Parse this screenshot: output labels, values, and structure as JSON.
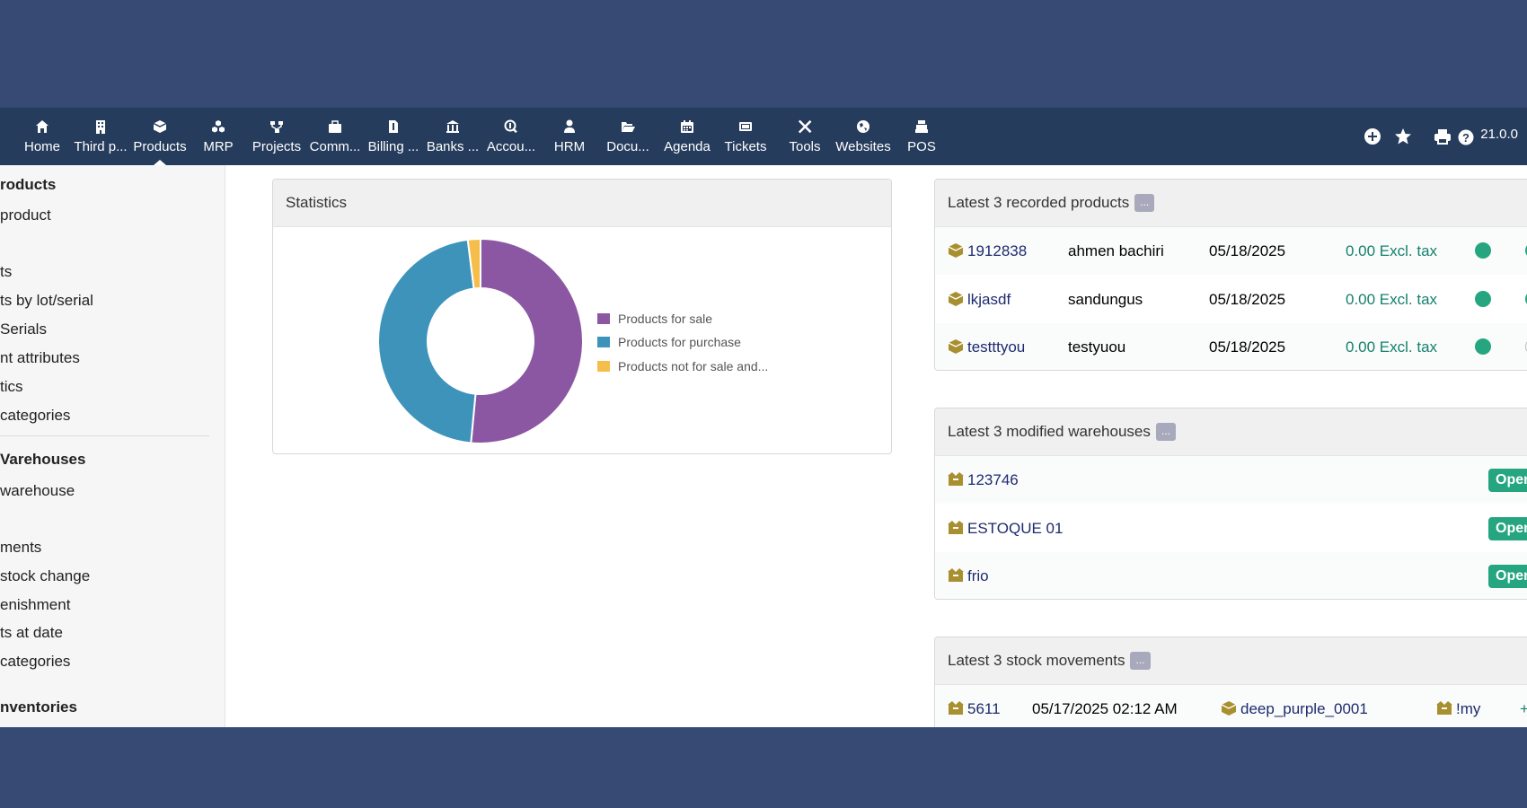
{
  "menu": [
    {
      "label": "Home",
      "icon": "home-icon"
    },
    {
      "label": "Third p...",
      "icon": "building-icon"
    },
    {
      "label": "Products",
      "icon": "cube-icon",
      "active": true
    },
    {
      "label": "MRP",
      "icon": "cubes-icon"
    },
    {
      "label": "Projects",
      "icon": "sitemap-icon"
    },
    {
      "label": "Comm...",
      "icon": "suitcase-icon"
    },
    {
      "label": "Billing ...",
      "icon": "invoice-icon"
    },
    {
      "label": "Banks ...",
      "icon": "bank-icon"
    },
    {
      "label": "Accou...",
      "icon": "search-dollar-icon"
    },
    {
      "label": "HRM",
      "icon": "user-tie-icon"
    },
    {
      "label": "Docu...",
      "icon": "folder-open-icon"
    },
    {
      "label": "Agenda",
      "icon": "calendar-icon"
    },
    {
      "label": "Tickets",
      "icon": "ticket-icon"
    },
    {
      "label": "Tools",
      "icon": "tools-icon"
    },
    {
      "label": "Websites",
      "icon": "globe-icon"
    },
    {
      "label": "POS",
      "icon": "cash-register-icon"
    }
  ],
  "top_right": {
    "version": "21.0.0"
  },
  "sidebar": {
    "products_title": "roducts",
    "products_items": [
      "product",
      "",
      "ts",
      "ts by lot/serial",
      "Serials",
      "nt attributes",
      "tics",
      "categories"
    ],
    "warehouses_title": "Varehouses",
    "warehouses_items": [
      "warehouse",
      "",
      "ments",
      "stock change",
      "enishment",
      "ts at date",
      "categories"
    ],
    "inventories_title": "nventories"
  },
  "statistics": {
    "title": "Statistics",
    "chart_data": {
      "type": "pie",
      "categories": [
        "Products for sale",
        "Products for purchase",
        "Products not for sale and..."
      ],
      "values": [
        51.5,
        46.5,
        2.0
      ],
      "colors": [
        "#8b57a3",
        "#3e93bb",
        "#f5be4b"
      ],
      "legend_position": "right"
    }
  },
  "latest_products": {
    "title": "Latest 3 recorded products",
    "more": "...",
    "rows": [
      {
        "ref": "1912838",
        "label": "ahmen bachiri",
        "date": "05/18/2025",
        "price": "0.00 Excl. tax"
      },
      {
        "ref": "lkjasdf",
        "label": "sandungus",
        "date": "05/18/2025",
        "price": "0.00 Excl. tax"
      },
      {
        "ref": "testttyou",
        "label": "testyuou",
        "date": "05/18/2025",
        "price": "0.00 Excl. tax"
      }
    ]
  },
  "latest_warehouses": {
    "title": "Latest 3 modified warehouses",
    "more": "...",
    "rows": [
      {
        "ref": "123746",
        "status": "Open"
      },
      {
        "ref": "ESTOQUE 01",
        "status": "Open"
      },
      {
        "ref": "frio",
        "status": "Open"
      }
    ]
  },
  "latest_movements": {
    "title": "Latest 3 stock movements",
    "more": "...",
    "rows": [
      {
        "ref": "5611",
        "date": "05/17/2025 02:12 AM",
        "product": "deep_purple_0001",
        "warehouse": "!my",
        "qty": "+"
      }
    ]
  },
  "colors": {
    "topbar": "#263c5c",
    "status_green": "#25a580",
    "link": "#1e2a6e"
  }
}
